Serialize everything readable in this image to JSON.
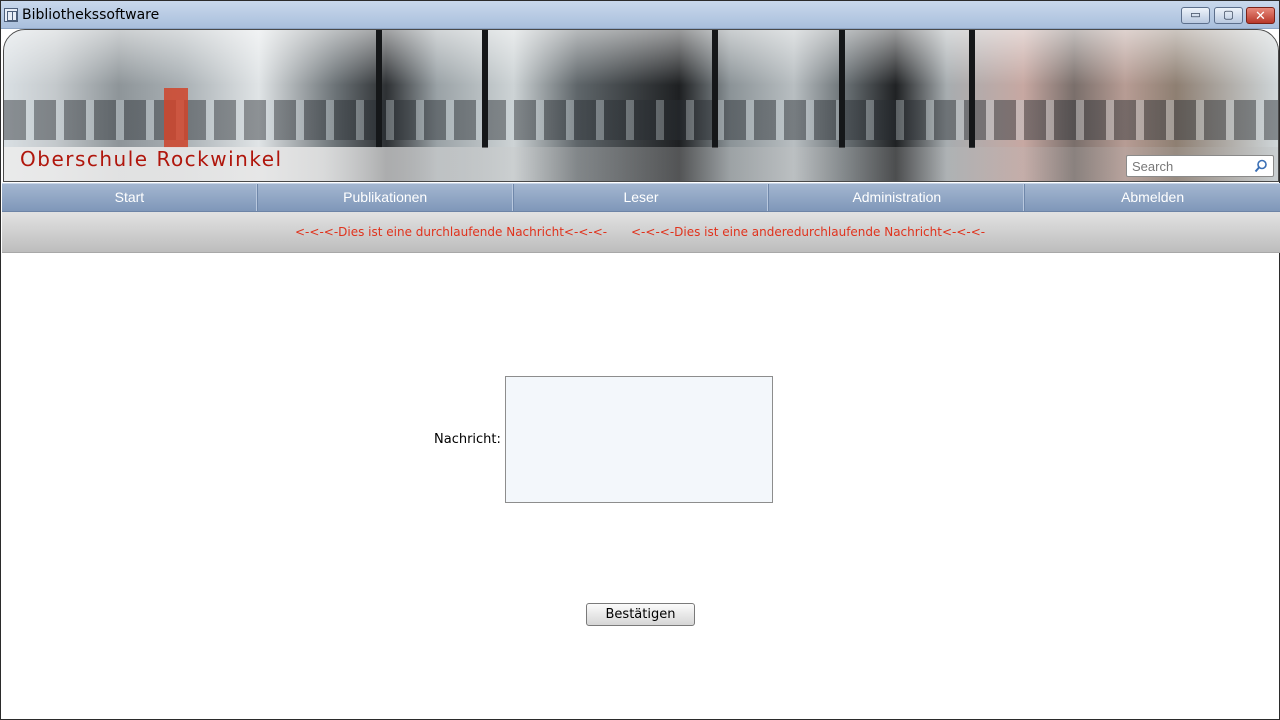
{
  "window": {
    "title": "Bibliothekssoftware",
    "controls": {
      "minimize": "▭",
      "maximize": "▢",
      "close": "✕"
    }
  },
  "banner": {
    "school_name": "Oberschule Rockwinkel",
    "search_placeholder": "Search"
  },
  "nav": {
    "items": [
      "Start",
      "Publikationen",
      "Leser",
      "Administration",
      "Abmelden"
    ]
  },
  "ticker": {
    "messages": [
      "<-<-<-Dies ist eine durchlaufende Nachricht<-<-<-",
      "<-<-<-Dies ist eine anderedurchlaufende Nachricht<-<-<-"
    ],
    "color": "#e0321c"
  },
  "form": {
    "message_label": "Nachricht:",
    "message_value": "",
    "submit_label": "Bestätigen"
  },
  "colors": {
    "nav_bar": "#8ea4c4",
    "school_name": "#b0160c",
    "titlebar": "#b8cbe4"
  }
}
